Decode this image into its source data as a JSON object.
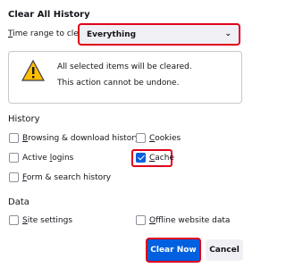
{
  "dialog": {
    "title": "Clear All History",
    "time_range": {
      "label_underlined": "T",
      "label_rest": "ime range to clear:",
      "value": "Everything"
    },
    "warning": {
      "line1": "All selected items will be cleared.",
      "line2": "This action cannot be undone."
    },
    "history": {
      "heading": "History",
      "browsing": {
        "u": "B",
        "rest": "rowsing & download history",
        "checked": false
      },
      "cookies": {
        "u": "C",
        "rest": "ookies",
        "checked": false
      },
      "logins": {
        "pre": "Active ",
        "u": "l",
        "rest": "ogins",
        "checked": false
      },
      "cache": {
        "u": "C",
        "rest": "ache",
        "checked": true
      },
      "forms": {
        "u": "F",
        "rest": "orm & search history",
        "checked": false
      }
    },
    "data": {
      "heading": "Data",
      "site": {
        "u": "S",
        "rest": "ite settings",
        "checked": false
      },
      "offline": {
        "u": "O",
        "rest": "ffline website data",
        "checked": false
      }
    },
    "buttons": {
      "clear_now": "Clear Now",
      "cancel": "Cancel"
    },
    "colors": {
      "accent": "#0060df",
      "highlight": "#e0001b",
      "warning": "#ffbf00"
    }
  }
}
